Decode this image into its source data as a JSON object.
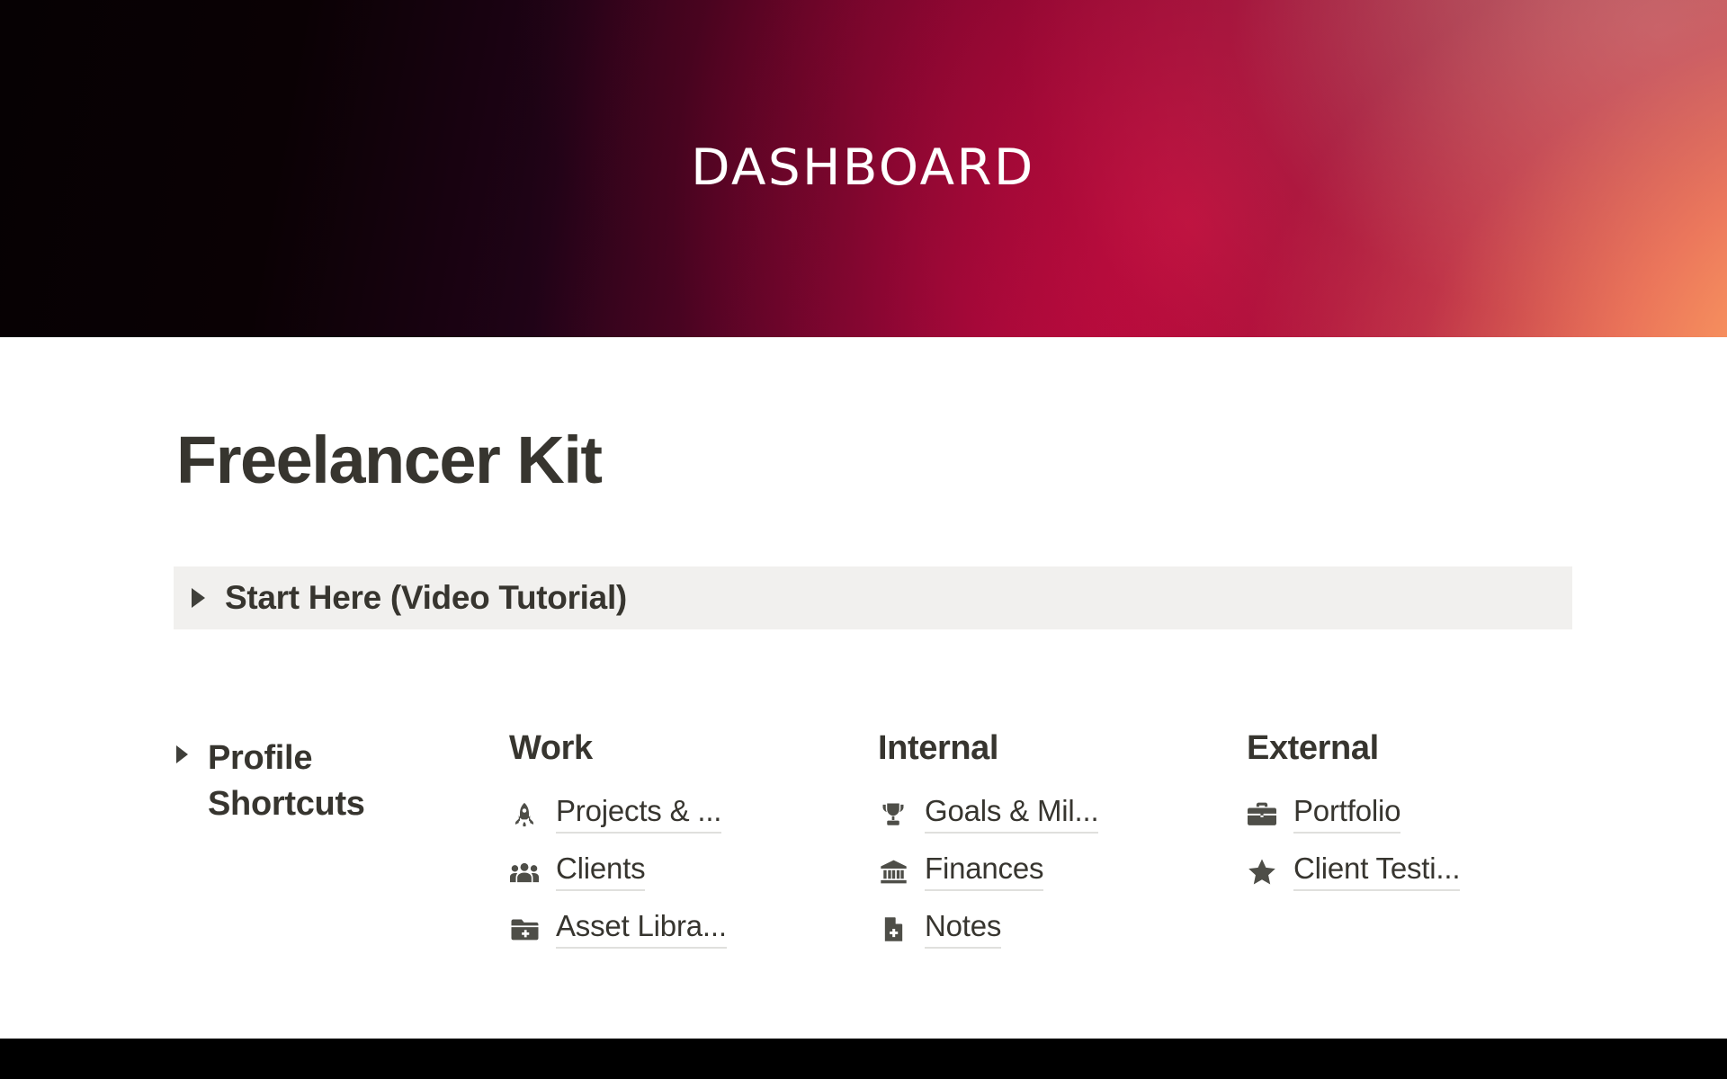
{
  "banner": {
    "title": "DASHBOARD",
    "gradient_colors": {
      "left": "#060103",
      "mid_dark": "#200317",
      "crimson": "#c81051",
      "salmon": "#f0705f",
      "orange": "#ffb277",
      "rose_top_right": "#c4787c"
    }
  },
  "page": {
    "title": "Freelancer Kit",
    "text_color": "#37352f"
  },
  "start_here": {
    "label": "Start Here (Video Tutorial)",
    "toggle_icon": "triangle-right-icon",
    "background": "#f1f0ee",
    "expanded": false
  },
  "profile": {
    "label": "Profile Shortcuts",
    "toggle_icon": "triangle-right-icon",
    "expanded": false
  },
  "columns": [
    {
      "heading": "Work",
      "links": [
        {
          "icon": "rocket-icon",
          "label": "Projects & ..."
        },
        {
          "icon": "people-group-icon",
          "label": "Clients"
        },
        {
          "icon": "folder-plus-icon",
          "label": "Asset Libra..."
        }
      ]
    },
    {
      "heading": "Internal",
      "links": [
        {
          "icon": "trophy-icon",
          "label": "Goals & Mil..."
        },
        {
          "icon": "bank-icon",
          "label": "Finances"
        },
        {
          "icon": "document-plus-icon",
          "label": "Notes"
        }
      ]
    },
    {
      "heading": "External",
      "links": [
        {
          "icon": "briefcase-icon",
          "label": "Portfolio"
        },
        {
          "icon": "star-icon",
          "label": "Client Testi..."
        }
      ]
    }
  ],
  "link_underline_color": "#e0e0dd",
  "icon_color": "#4e4e48",
  "bottom_band_color": "#000000"
}
